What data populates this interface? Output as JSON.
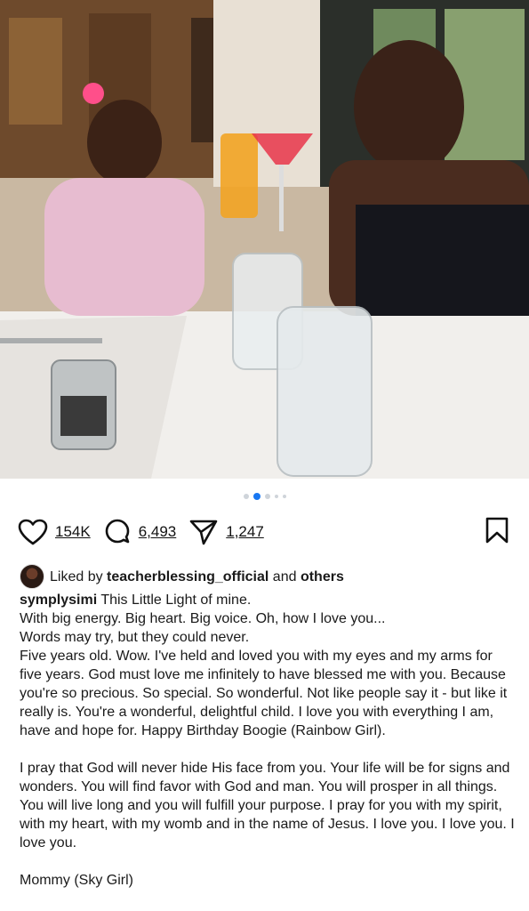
{
  "carousel": {
    "count": 5,
    "active": 1
  },
  "actions": {
    "likes": "154K",
    "comments": "6,493",
    "shares": "1,247"
  },
  "liked_by": {
    "prefix": "Liked by",
    "user": "teacherblessing_official",
    "middle": "and",
    "suffix": "others"
  },
  "caption": {
    "username": "symplysimi",
    "first_line": "This Little Light of mine.",
    "paragraphs": [
      "With big energy. Big heart. Big voice. Oh, how I love you...",
      "Words may try, but they could never.",
      "Five years old. Wow. I've held and loved you with my eyes and my arms for five years. God must love me infinitely to have blessed me with you. Because you're so precious. So special. So wonderful. Not like people say it - but like it really is. You're a wonderful, delightful child. I love you with everything I am, have and hope for. Happy Birthday Boogie (Rainbow Girl).",
      "I pray that God will never hide His face from you. Your life will be for signs and wonders. You will find favor with God and man. You will prosper in all things. You will live long and you will fulfill your purpose. I pray for you with my spirit, with my heart, with my womb and in the name of Jesus. I love you. I love you. I love you.",
      "Mommy (Sky Girl)"
    ]
  }
}
